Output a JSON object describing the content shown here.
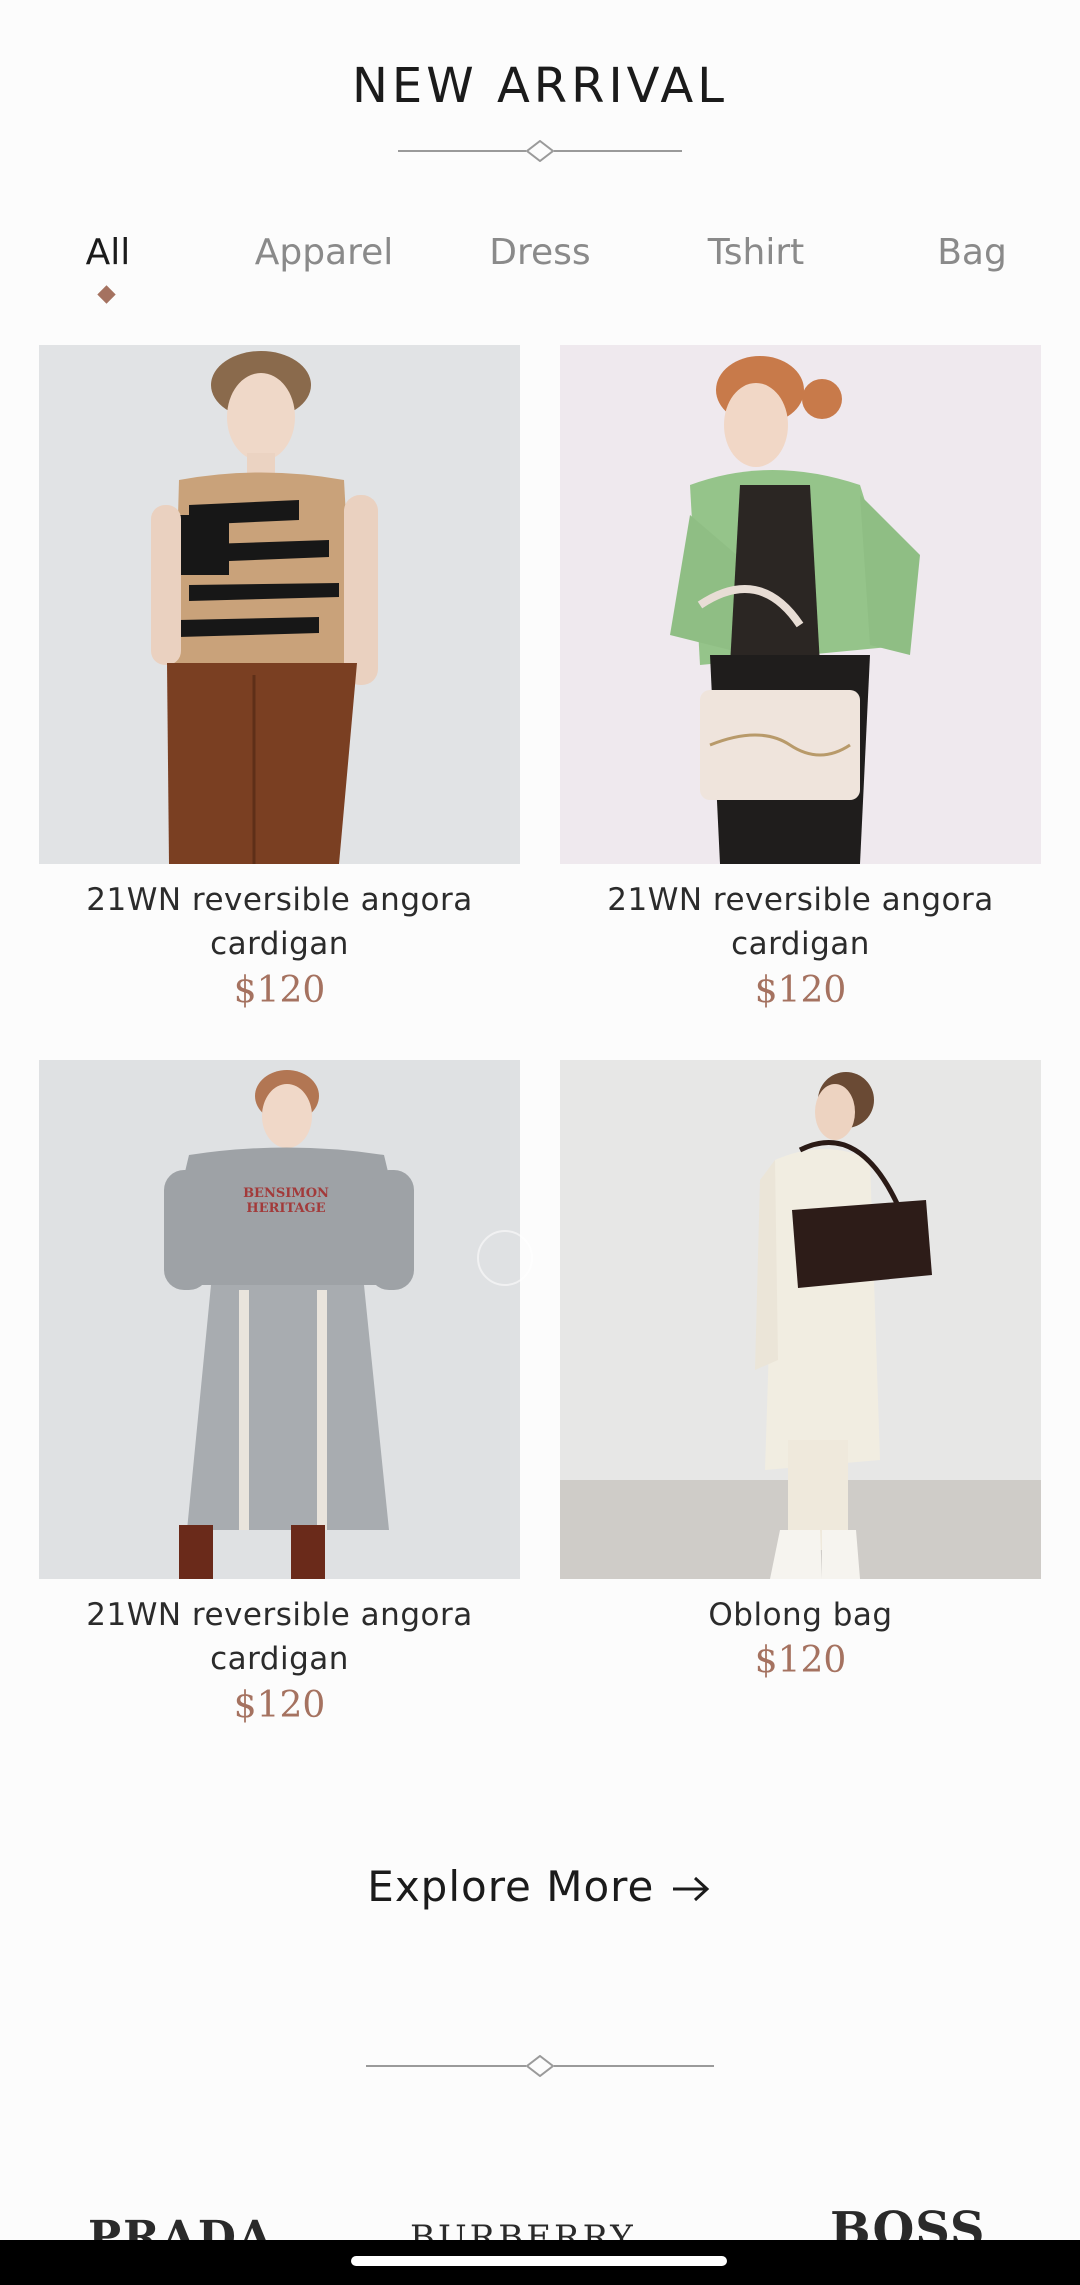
{
  "section": {
    "title": "NEW ARRIVAL"
  },
  "tabs": [
    {
      "label": "All",
      "active": true
    },
    {
      "label": "Apparel",
      "active": false
    },
    {
      "label": "Dress",
      "active": false
    },
    {
      "label": "Tshirt",
      "active": false
    },
    {
      "label": "Bag",
      "active": false
    }
  ],
  "products": [
    {
      "name_line1": "21WN reversible angora",
      "name_line2": "cardigan",
      "price": "$120",
      "image": "model in tan and black knit vest with brown corduroy pants"
    },
    {
      "name_line1": "21WN reversible angora",
      "name_line2": "cardigan",
      "price": "$120",
      "image": "model in green cardigan holding cream handbag"
    },
    {
      "name_line1": "21WN reversible angora",
      "name_line2": "cardigan",
      "price": "$120",
      "image": "model in grey sweatshirt and grey striped skirt",
      "print": "BENSIMON HERITAGE"
    },
    {
      "name_line1": "Oblong bag",
      "name_line2": "",
      "price": "$120",
      "image": "model in long white cardigan with dark brown shoulder bag"
    }
  ],
  "explore": {
    "label": "Explore More"
  },
  "brands": [
    "PRADA",
    "BURBERRY",
    "BOSS"
  ],
  "colors": {
    "accent": "#a57260",
    "background": "#fcfcfc",
    "text": "#1b1b1b",
    "muted": "#8a8a8a"
  }
}
